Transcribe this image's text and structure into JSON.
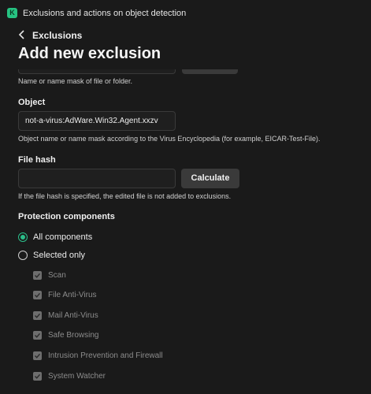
{
  "window": {
    "title": "Exclusions and actions on object detection",
    "app_icon_glyph": "K"
  },
  "nav": {
    "back_label": "Exclusions"
  },
  "page": {
    "title": "Add new exclusion"
  },
  "file_or_folder": {
    "hint": "Name or name mask of file or folder."
  },
  "object": {
    "label": "Object",
    "value": "not-a-virus:AdWare.Win32.Agent.xxzv",
    "hint": "Object name or name mask according to the Virus Encyclopedia (for example, EICAR-Test-File)."
  },
  "file_hash": {
    "label": "File hash",
    "value": "",
    "calculate_label": "Calculate",
    "hint": "If the file hash is specified, the edited file is not added to exclusions."
  },
  "protection": {
    "label": "Protection components",
    "options": [
      {
        "label": "All components",
        "checked": true
      },
      {
        "label": "Selected only",
        "checked": false
      }
    ],
    "components": [
      {
        "label": "Scan",
        "checked": true
      },
      {
        "label": "File Anti-Virus",
        "checked": true
      },
      {
        "label": "Mail Anti-Virus",
        "checked": true
      },
      {
        "label": "Safe Browsing",
        "checked": true
      },
      {
        "label": "Intrusion Prevention and Firewall",
        "checked": true
      },
      {
        "label": "System Watcher",
        "checked": true
      }
    ]
  },
  "colors": {
    "accent": "#2bbf8a",
    "background": "#1a1a1a",
    "button": "#3a3a3a"
  }
}
